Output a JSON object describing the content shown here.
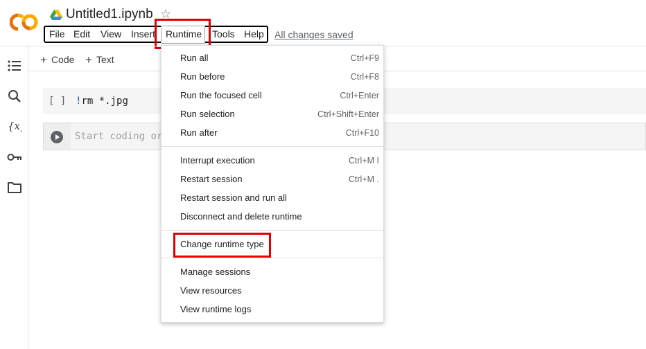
{
  "header": {
    "title": "Untitled1.ipynb",
    "saved_status": "All changes saved"
  },
  "menubar": {
    "items": [
      {
        "label": "File"
      },
      {
        "label": "Edit"
      },
      {
        "label": "View"
      },
      {
        "label": "Insert"
      },
      {
        "label": "Runtime"
      },
      {
        "label": "Tools"
      },
      {
        "label": "Help"
      }
    ]
  },
  "toolbar": {
    "code_label": "Code",
    "text_label": "Text"
  },
  "cells": {
    "cell1_bracket": "[ ]",
    "cell1_bang": "!",
    "cell1_code": "rm *.jpg",
    "cell2_placeholder": "Start coding or"
  },
  "runtime_menu": {
    "groups": [
      [
        {
          "label": "Run all",
          "shortcut": "Ctrl+F9"
        },
        {
          "label": "Run before",
          "shortcut": "Ctrl+F8"
        },
        {
          "label": "Run the focused cell",
          "shortcut": "Ctrl+Enter"
        },
        {
          "label": "Run selection",
          "shortcut": "Ctrl+Shift+Enter"
        },
        {
          "label": "Run after",
          "shortcut": "Ctrl+F10"
        }
      ],
      [
        {
          "label": "Interrupt execution",
          "shortcut": "Ctrl+M I"
        },
        {
          "label": "Restart session",
          "shortcut": "Ctrl+M ."
        },
        {
          "label": "Restart session and run all",
          "shortcut": ""
        },
        {
          "label": "Disconnect and delete runtime",
          "shortcut": ""
        }
      ],
      [
        {
          "label": "Change runtime type",
          "shortcut": ""
        }
      ],
      [
        {
          "label": "Manage sessions",
          "shortcut": ""
        },
        {
          "label": "View resources",
          "shortcut": ""
        },
        {
          "label": "View runtime logs",
          "shortcut": ""
        }
      ]
    ]
  },
  "icons": {
    "logo": "colab-logo",
    "drive": "google-drive-icon",
    "star": "star-icon",
    "sidebar": [
      "table-of-contents-icon",
      "search-icon",
      "variables-icon",
      "secrets-key-icon",
      "files-folder-icon"
    ],
    "run": "run-cell-icon"
  },
  "colors": {
    "highlight": "#e00000",
    "logo_orange": "#f9ab00",
    "logo_dark_orange": "#e8710a"
  }
}
